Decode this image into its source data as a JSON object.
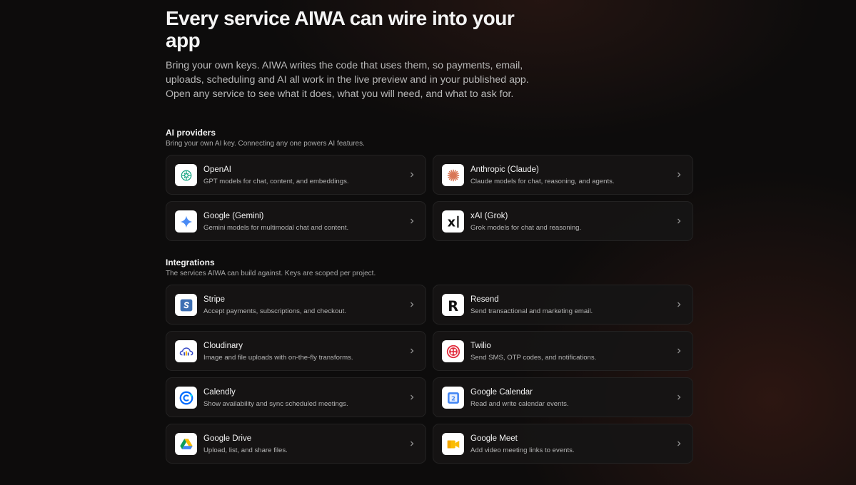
{
  "hero": {
    "title": "Every service AIWA can wire into your app",
    "description": "Bring your own keys. AIWA writes the code that uses them, so payments, email, uploads, scheduling and AI all work in the live preview and in your published app. Open any service to see what it does, what you will need, and what to ask for."
  },
  "ai_providers": {
    "title": "AI providers",
    "subtitle": "Bring your own AI key. Connecting any one powers AI features.",
    "items": [
      {
        "name": "OpenAI",
        "description": "GPT models for chat, content, and embeddings.",
        "icon": "openai-icon"
      },
      {
        "name": "Anthropic (Claude)",
        "description": "Claude models for chat, reasoning, and agents.",
        "icon": "anthropic-icon"
      },
      {
        "name": "Google (Gemini)",
        "description": "Gemini models for multimodal chat and content.",
        "icon": "gemini-icon"
      },
      {
        "name": "xAI (Grok)",
        "description": "Grok models for chat and reasoning.",
        "icon": "xai-icon"
      }
    ]
  },
  "integrations": {
    "title": "Integrations",
    "subtitle": "The services AIWA can build against. Keys are scoped per project.",
    "items": [
      {
        "name": "Stripe",
        "description": "Accept payments, subscriptions, and checkout.",
        "icon": "stripe-icon"
      },
      {
        "name": "Resend",
        "description": "Send transactional and marketing email.",
        "icon": "resend-icon"
      },
      {
        "name": "Cloudinary",
        "description": "Image and file uploads with on-the-fly transforms.",
        "icon": "cloudinary-icon"
      },
      {
        "name": "Twilio",
        "description": "Send SMS, OTP codes, and notifications.",
        "icon": "twilio-icon"
      },
      {
        "name": "Calendly",
        "description": "Show availability and sync scheduled meetings.",
        "icon": "calendly-icon"
      },
      {
        "name": "Google Calendar",
        "description": "Read and write calendar events.",
        "icon": "google-calendar-icon"
      },
      {
        "name": "Google Drive",
        "description": "Upload, list, and share files.",
        "icon": "google-drive-icon"
      },
      {
        "name": "Google Meet",
        "description": "Add video meeting links to events.",
        "icon": "google-meet-icon"
      }
    ]
  },
  "colors": {
    "background": "#0d0c0c",
    "card": "#161515",
    "card_border": "#232222",
    "text_primary": "#f3f3f3",
    "text_secondary": "#b4b4b4"
  },
  "icon_glyphs": {
    "resend": "R",
    "xai": "x",
    "google_calendar": "2"
  }
}
